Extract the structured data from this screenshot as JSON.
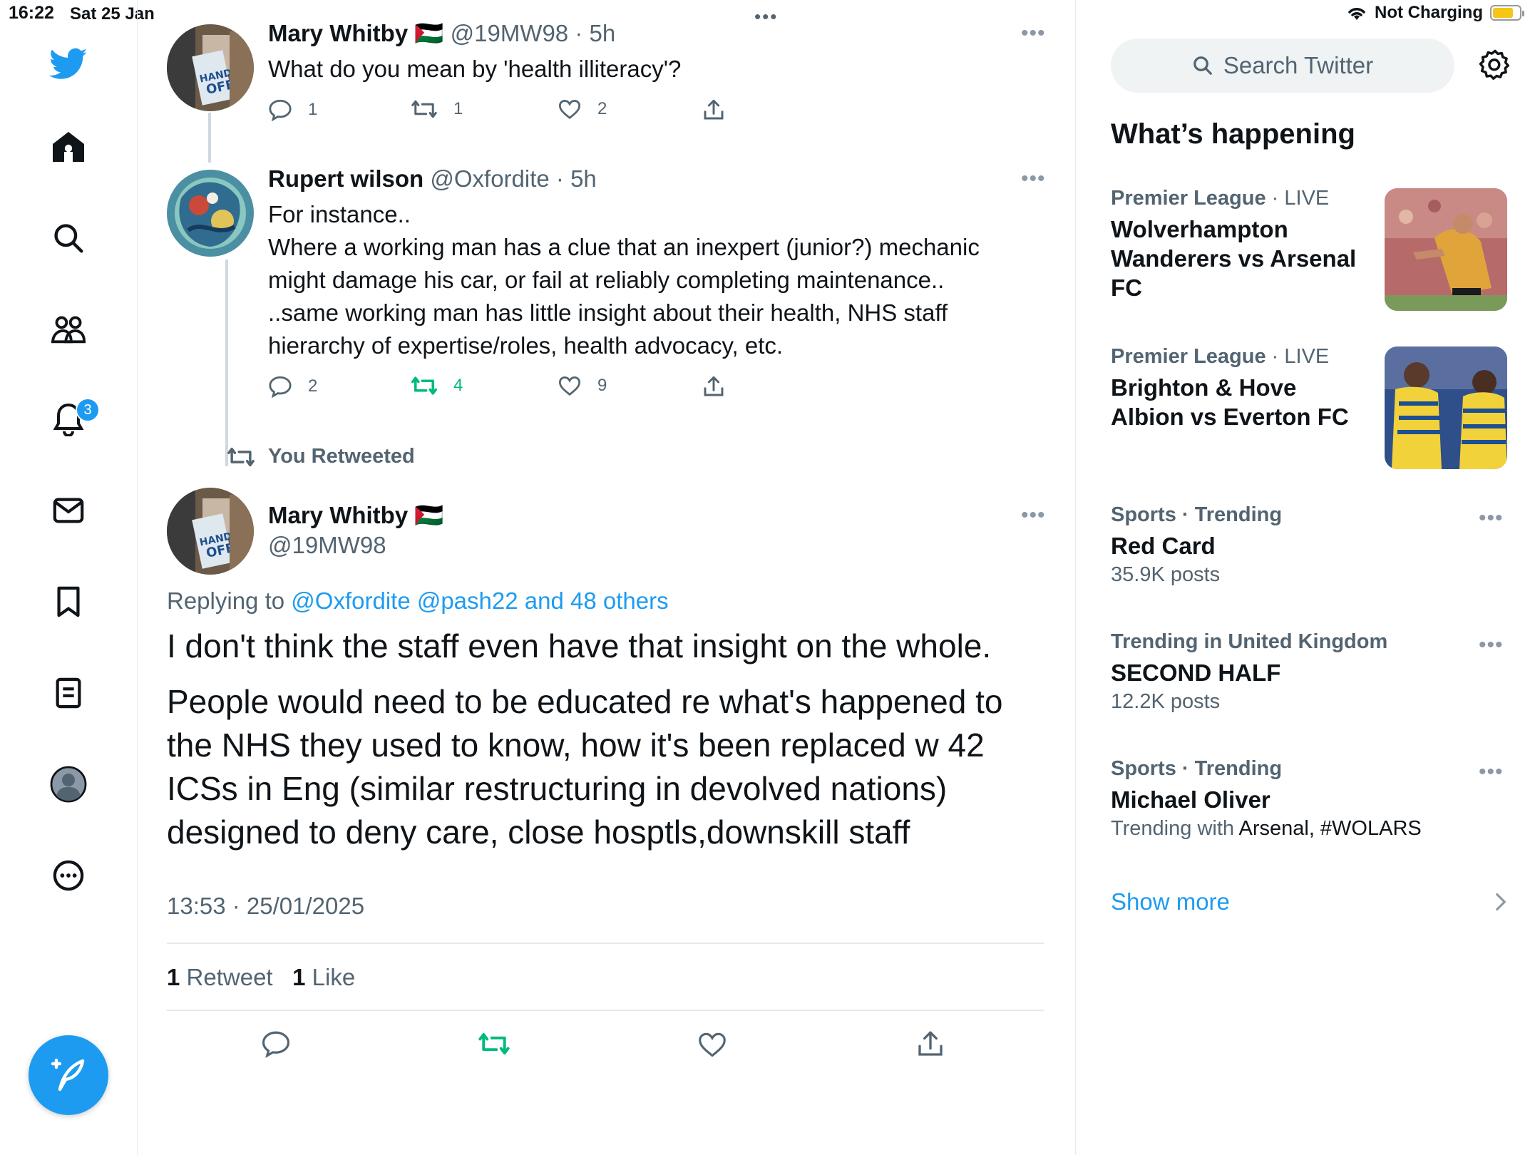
{
  "status": {
    "time": "16:22",
    "date": "Sat 25 Jan",
    "dots": "•••",
    "charging": "Not Charging",
    "battery_level": 0.78
  },
  "nav": {
    "notifications_badge": "3",
    "icons": [
      "twitter-logo-icon",
      "home-icon",
      "search-icon",
      "communities-icon",
      "notifications-icon",
      "messages-icon",
      "bookmarks-icon",
      "lists-icon",
      "profile-icon",
      "more-icon"
    ]
  },
  "thread": [
    {
      "name": "Mary Whitby 🇵🇸",
      "handle_time": "@19MW98 · 5h",
      "text": "What do you mean by 'health illiteracy'?",
      "replies": "1",
      "retweets": "1",
      "likes": "2"
    },
    {
      "name": "Rupert wilson",
      "handle_time": "@Oxfordite · 5h",
      "lines": [
        "For instance..",
        "Where a working man has a clue that an inexpert (junior?) mechanic",
        "might damage his car, or fail at reliably completing maintenance..",
        "..same working man has little insight about their health, NHS staff",
        "hierarchy of expertise/roles, health advocacy, etc."
      ],
      "replies": "2",
      "retweets": "4",
      "likes": "9"
    }
  ],
  "main_tweet": {
    "retweeted_label": "You Retweeted",
    "name": "Mary Whitby 🇵🇸",
    "handle": "@19MW98",
    "replying_prefix": "Replying to",
    "replying_to": "@Oxfordite @pash22 and 48 others",
    "para1": "I don't think the staff even have that insight on the whole.",
    "para2_lines": [
      "People would need to be educated re what's happened to",
      "the NHS they used to know, how it's been replaced w 42",
      "ICSs in Eng (similar restructuring in devolved nations)",
      "designed to deny care, close hosptls,downskill staff"
    ],
    "timestamp": "13:53 · 25/01/2025",
    "retweet_count": "1",
    "retweet_label": "Retweet",
    "like_count": "1",
    "like_label": "Like"
  },
  "sidebar": {
    "search_placeholder": "Search Twitter",
    "heading": "What’s happening",
    "trends": [
      {
        "category": "Premier League",
        "status": "· LIVE",
        "title_lines": [
          "Wolverhampton",
          "Wanderers vs Arsenal",
          "FC"
        ]
      },
      {
        "category": "Premier League",
        "status": "· LIVE",
        "title_lines": [
          "Brighton & Hove",
          "Albion vs Everton FC"
        ]
      },
      {
        "category": "Sports · Trending",
        "title": "Red Card",
        "sub": "35.9K posts"
      },
      {
        "category": "Trending in United Kingdom",
        "title": "SECOND HALF",
        "sub": "12.2K posts"
      },
      {
        "category": "Sports · Trending",
        "title": "Michael Oliver",
        "sub_prefix": "Trending with",
        "sub_tags": "Arsenal, #WOLARS"
      }
    ],
    "show_more": "Show more"
  },
  "colors": {
    "accent": "#1d9bf0",
    "retweet_green": "#00ba7c",
    "muted": "#536471"
  }
}
